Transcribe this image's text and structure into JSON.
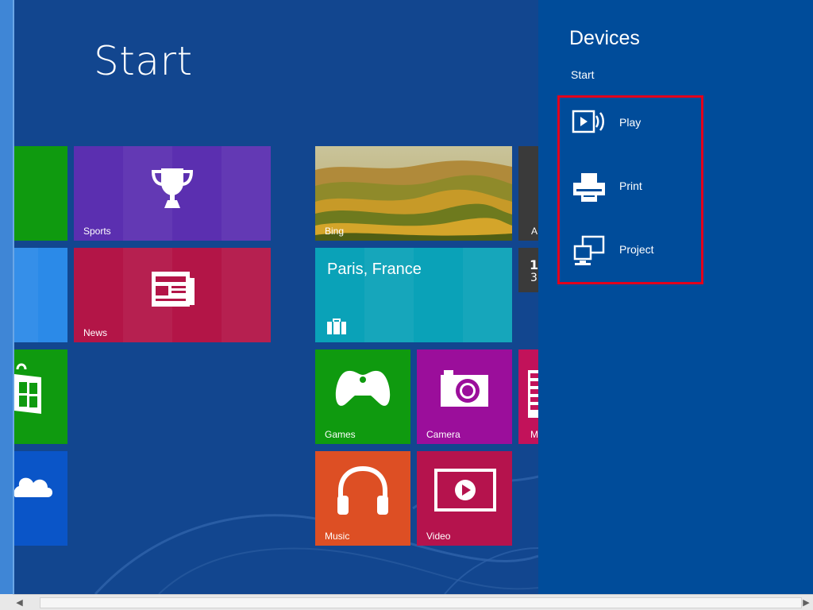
{
  "start": {
    "title": "Start"
  },
  "tiles": {
    "sports": "Sports",
    "news": "News",
    "bing": "Bing",
    "paris": "Paris, France",
    "games": "Games",
    "camera": "Camera",
    "music": "Music",
    "video": "Video",
    "partial_a": "A",
    "partial_m": "M",
    "partial_num": "1",
    "partial_num2": "3"
  },
  "devices": {
    "title": "Devices",
    "subtitle": "Start",
    "items": [
      {
        "label": "Play",
        "icon": "play-to-device-icon"
      },
      {
        "label": "Print",
        "icon": "printer-icon"
      },
      {
        "label": "Project",
        "icon": "projector-monitor-icon"
      }
    ],
    "highlight_color": "#e3001b"
  },
  "colors": {
    "start_bg": "#12468f",
    "pane_bg": "#004c9a",
    "sports": "#5b2fb0",
    "news": "#b31547",
    "paris": "#0aa2b8",
    "games": "#0f9a0f",
    "camera": "#9b0e9b",
    "music": "#dd4f24",
    "video": "#b5134d"
  }
}
